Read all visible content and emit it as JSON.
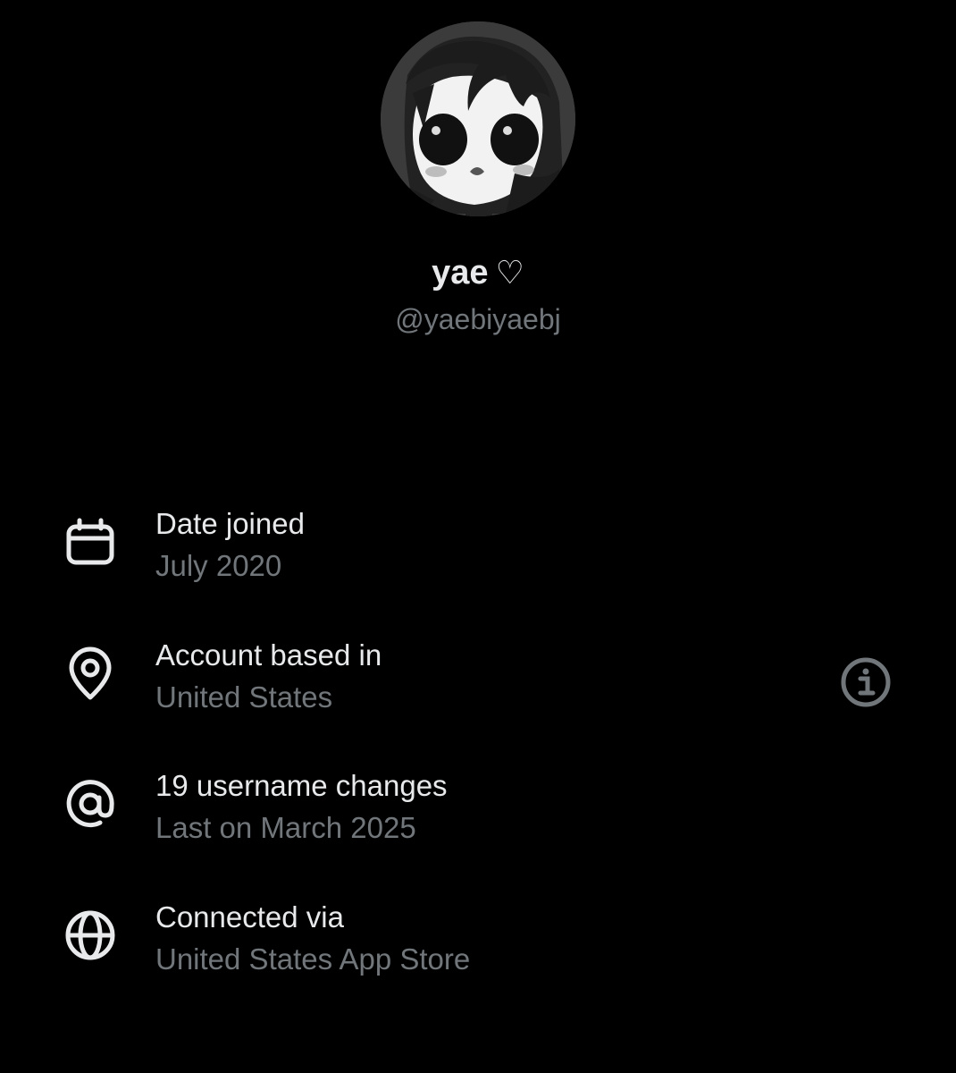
{
  "profile": {
    "display_name": "yae",
    "name_symbol": "♡",
    "handle": "@yaebiyaebj"
  },
  "rows": [
    {
      "icon": "calendar-icon",
      "title": "Date joined",
      "subtitle": "July 2020"
    },
    {
      "icon": "location-pin-icon",
      "title": "Account based in",
      "subtitle": "United States",
      "trailing_icon": "info-icon"
    },
    {
      "icon": "at-sign-icon",
      "title": "19 username changes",
      "subtitle": "Last on March 2025"
    },
    {
      "icon": "globe-icon",
      "title": "Connected via",
      "subtitle": "United States App Store"
    }
  ],
  "colors": {
    "background": "#000000",
    "primary_text": "#e7e9ea",
    "secondary_text": "#71767b"
  }
}
